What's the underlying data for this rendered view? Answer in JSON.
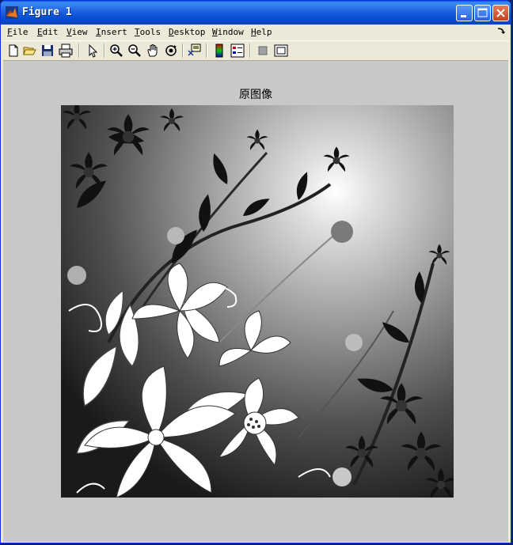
{
  "window": {
    "title": "Figure 1",
    "icons": {
      "app": "matlab-logo-icon",
      "minimize": "minimize-icon",
      "maximize": "maximize-icon",
      "close": "close-icon"
    }
  },
  "menubar": {
    "items": [
      {
        "label": "File"
      },
      {
        "label": "Edit"
      },
      {
        "label": "View"
      },
      {
        "label": "Insert"
      },
      {
        "label": "Tools"
      },
      {
        "label": "Desktop"
      },
      {
        "label": "Window"
      },
      {
        "label": "Help"
      }
    ],
    "overflow_icon": "curved-arrow-icon"
  },
  "toolbar": {
    "icons": [
      "new-figure-icon",
      "open-file-icon",
      "save-icon",
      "print-icon",
      "edit-plot-arrow-icon",
      "zoom-in-icon",
      "zoom-out-icon",
      "pan-hand-icon",
      "rotate-3d-icon",
      "data-cursor-icon",
      "insert-colorbar-icon",
      "insert-legend-icon",
      "hide-plot-tools-icon",
      "show-plot-tools-icon"
    ]
  },
  "figure": {
    "axes_title": "原图像",
    "image_description_icon": "grayscale-floral-image"
  },
  "colors": {
    "titlebar": "#0b4fd2",
    "figure_background": "#c8c8c8",
    "chrome": "#ece9d8"
  }
}
